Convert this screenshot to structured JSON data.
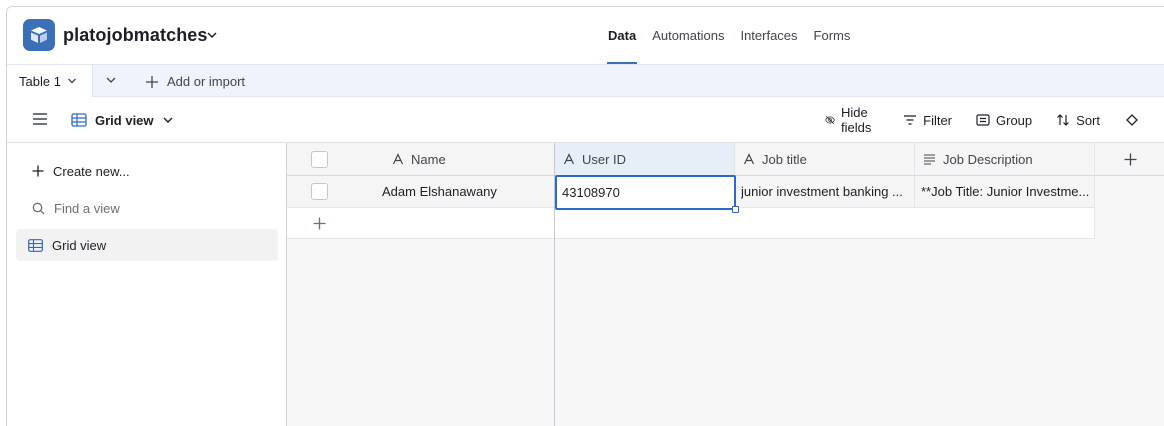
{
  "app": {
    "base_name": "platojobmatches",
    "nav": [
      "Data",
      "Automations",
      "Interfaces",
      "Forms"
    ],
    "active_nav": "Data"
  },
  "tables": {
    "active_tab": "Table 1",
    "add_import": "Add or import"
  },
  "view": {
    "name": "Grid view",
    "tools": [
      "Hide fields",
      "Filter",
      "Group",
      "Sort"
    ]
  },
  "sidebar": {
    "create_new": "Create new...",
    "find_placeholder": "Find a view",
    "views": [
      "Grid view"
    ]
  },
  "grid": {
    "columns": [
      "Name",
      "User ID",
      "Job title",
      "Job Description"
    ],
    "rows": [
      {
        "name": "Adam Elshanawany",
        "user_id": "43108970",
        "job_title": "junior investment banking ...",
        "job_description": "**Job Title: Junior Investme..."
      }
    ]
  },
  "colors": {
    "accent": "#3b6fb6",
    "selection": "#2d6ac7",
    "tabs_bg": "#eef3fc"
  }
}
